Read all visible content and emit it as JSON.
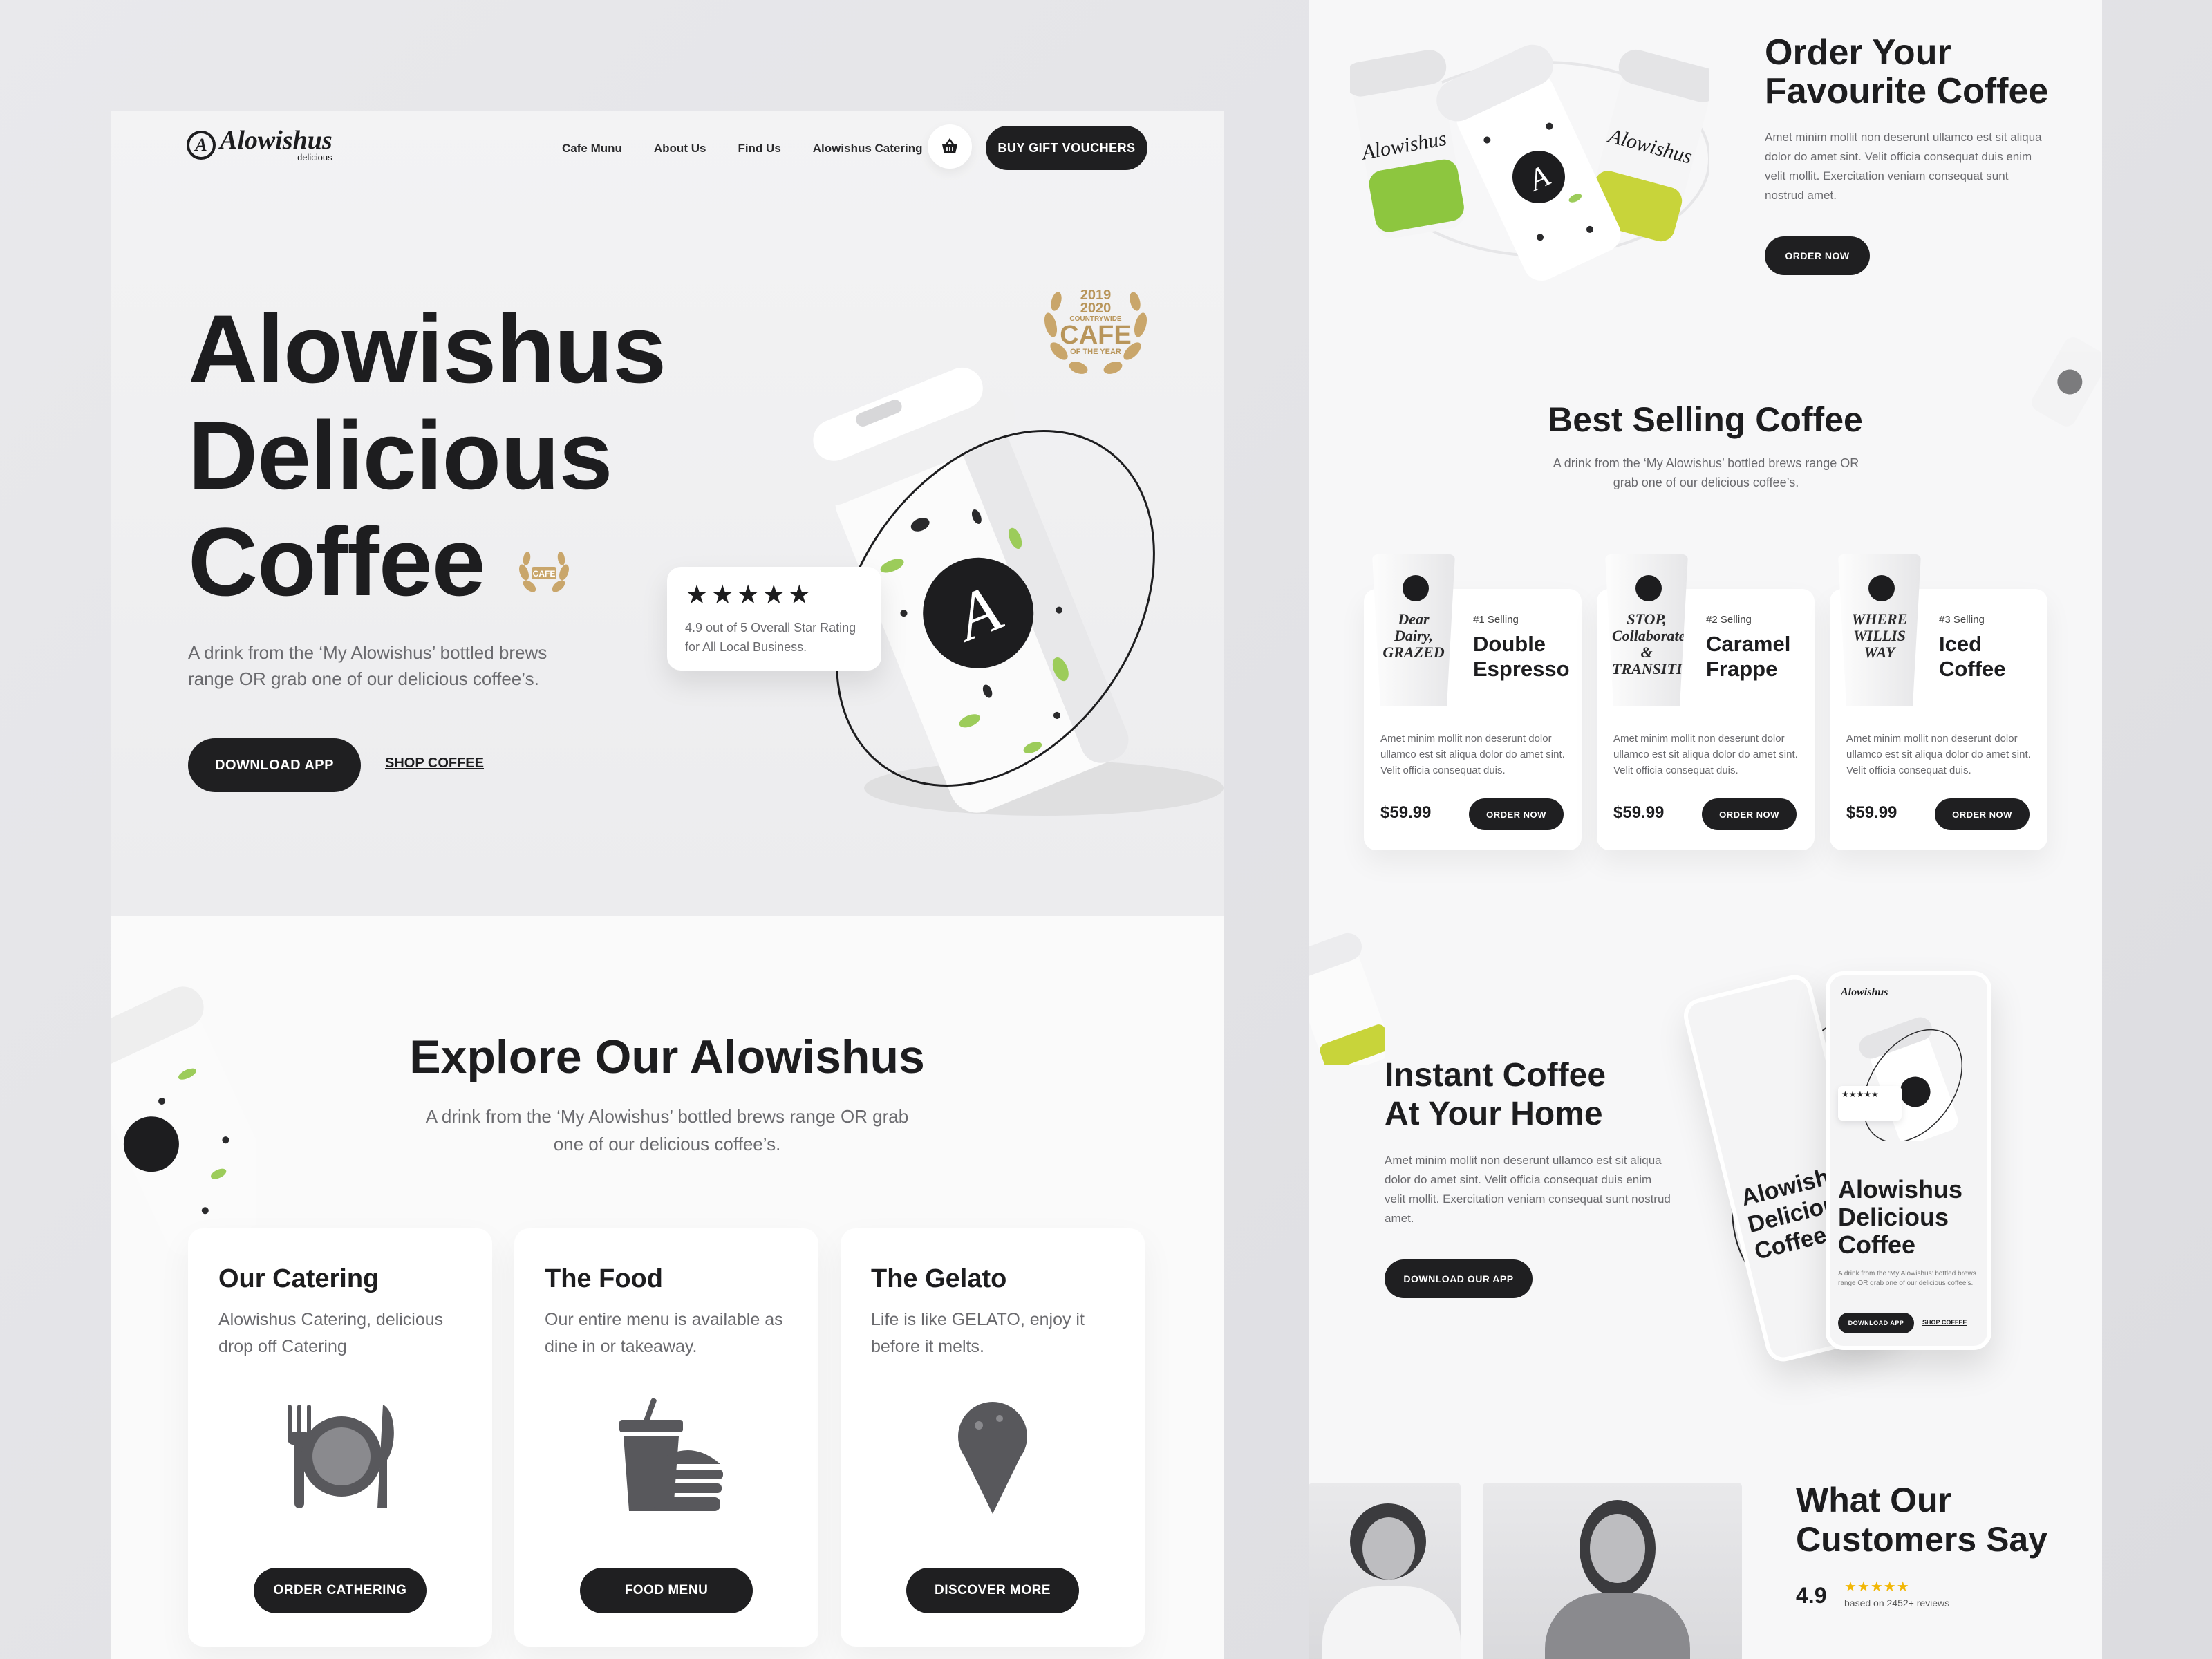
{
  "brand": {
    "name": "Alowishus",
    "tagline": "delicious",
    "mark": "A"
  },
  "nav": {
    "items": [
      "Cafe Munu",
      "About Us",
      "Find Us",
      "Alowishus Catering"
    ],
    "gift_button": "BUY GIFT VOUCHERS"
  },
  "hero": {
    "title_lines": [
      "Alowishus",
      "Delicious",
      "Coffee"
    ],
    "subtitle": "A drink from the ‘My Alowishus’ bottled brews range OR grab one of our delicious coffee’s.",
    "download_button": "DOWNLOAD APP",
    "shop_link": "SHOP COFFEE",
    "award": {
      "years": "2019 2020",
      "label": "CAFE",
      "line": "COUNTRYWIDE",
      "sub": "OF THE YEAR"
    },
    "rating_card": {
      "stars": "★★★★★",
      "text": "4.9 out of 5 Overall Star Rating for All Local Business."
    }
  },
  "explore": {
    "title": "Explore Our Alowishus",
    "subtitle": "A drink from the ‘My Alowishus’ bottled brews range OR grab one of our delicious coffee’s.",
    "cards": [
      {
        "title": "Our Catering",
        "text": "Alowishus Catering, delicious drop off Catering",
        "button": "ORDER CATHERING",
        "icon": "plate-cutlery-icon"
      },
      {
        "title": "The Food",
        "text": "Our entire menu is available as dine in or takeaway.",
        "button": "FOOD MENU",
        "icon": "burger-drink-icon"
      },
      {
        "title": "The Gelato",
        "text": "Life is like GELATO, enjoy it before it melts.",
        "button": "DISCOVER MORE",
        "icon": "ice-cream-icon"
      }
    ]
  },
  "order": {
    "title_lines": [
      "Order Your",
      "Favourite Coffee"
    ],
    "text": "Amet minim mollit non deserunt ullamco est sit aliqua dolor do amet sint. Velit officia consequat duis enim velit mollit. Exercitation veniam consequat sunt nostrud amet.",
    "button": "ORDER NOW"
  },
  "best_selling": {
    "title": "Best Selling Coffee",
    "subtitle": "A drink from the ‘My Alowishus’ bottled brews range OR grab one of our delicious coffee’s.",
    "products": [
      {
        "rank": "#1 Selling",
        "name": "Double Espresso",
        "desc": "Amet minim mollit non deserunt dolor ullamco est sit aliqua dolor do amet sint. Velit officia consequat duis.",
        "price": "$59.99",
        "button": "ORDER NOW",
        "cup_text": "Dear Dairy, GRAZED"
      },
      {
        "rank": "#2 Selling",
        "name": "Caramel Frappe",
        "desc": "Amet minim mollit non deserunt dolor ullamco est sit aliqua dolor do amet sint. Velit officia consequat duis.",
        "price": "$59.99",
        "button": "ORDER NOW",
        "cup_text": "STOP, Collaborate & TRANSITION"
      },
      {
        "rank": "#3 Selling",
        "name": "Iced Coffee",
        "desc": "Amet minim mollit non deserunt dolor ullamco est sit aliqua dolor do amet sint. Velit officia consequat duis.",
        "price": "$59.99",
        "button": "ORDER NOW",
        "cup_text": "WHERE WILLIS WAY"
      }
    ]
  },
  "instant": {
    "title_lines": [
      "Instant Coffee",
      "At Your Home"
    ],
    "text": "Amet minim mollit non deserunt ullamco est sit aliqua dolor do amet sint. Velit officia consequat duis enim velit mollit. Exercitation veniam consequat sunt nostrud amet.",
    "button": "DOWNLOAD OUR APP",
    "phone": {
      "title_lines": [
        "Alowishus",
        "Delicious",
        "Coffee"
      ],
      "text": "A drink from the ‘My Alowishus’ bottled brews range OR grab one of our delicious coffee’s.",
      "button": "DOWNLOAD APP",
      "link": "SHOP COFFEE"
    }
  },
  "customers": {
    "title_lines": [
      "What Our",
      "Customers Say"
    ],
    "score": "4.9",
    "stars": "★★★★★",
    "reviews": "based on 2452+ reviews"
  },
  "colors": {
    "dark": "#1f1f21",
    "accent_green": "#8dc63f",
    "accent_lime": "#c8d43a",
    "gold": "#b8955a",
    "star": "#f2b705"
  }
}
